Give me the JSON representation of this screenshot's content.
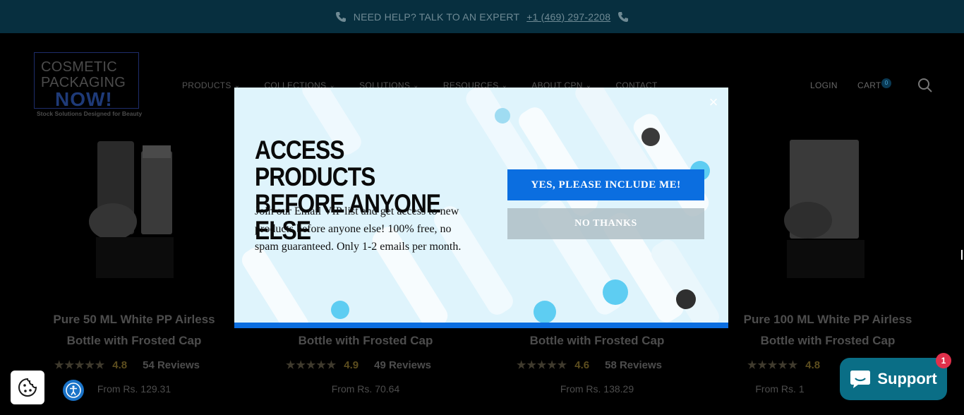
{
  "announcement": {
    "text": "NEED HELP? TALK TO AN EXPERT",
    "phone": "+1 (469) 297-2208"
  },
  "logo": {
    "line1": "COSMETIC",
    "line2": "PACKAGING",
    "line3": "NOW!",
    "tagline": "Stock Solutions Designed for Beauty"
  },
  "nav": {
    "items": [
      {
        "label": "PRODUCTS"
      },
      {
        "label": "COLLECTIONS"
      },
      {
        "label": "SOLUTIONS"
      },
      {
        "label": "RESOURCES"
      },
      {
        "label": "ABOUT CPN"
      },
      {
        "label": "CONTACT"
      }
    ],
    "login": "LOGIN",
    "cart": "CART",
    "cart_count": "0"
  },
  "products": [
    {
      "title_line1": "Pure 50 ML White PP Airless",
      "title_line2": "Bottle with Frosted Cap",
      "stars": "★★★★★",
      "rating": "4.8",
      "reviews": "54 Reviews",
      "price": "From Rs. 129.31"
    },
    {
      "title_line2": "Bottle with Frosted Cap",
      "stars": "★★★★★",
      "rating": "4.9",
      "reviews": "49 Reviews",
      "price": "From Rs. 70.64"
    },
    {
      "title_line2": "Bottle with Frosted Cap",
      "stars": "★★★★★",
      "rating": "4.6",
      "reviews": "58 Reviews",
      "price": "From Rs. 138.29"
    },
    {
      "title_line1": "Pure 100 ML White PP Airless",
      "title_line2": "Bottle with Frosted Cap",
      "stars": "★★★★★",
      "rating": "4.8",
      "price": "From Rs. 1"
    }
  ],
  "popup": {
    "heading_line1": "ACCESS PRODUCTS",
    "heading_line2": "BEFORE ANYONE ELSE",
    "body": "Join our Email VIP list and get access to new products before anyone else! 100% free, no spam guaranteed. Only 1-2 emails per month.",
    "yes_label": "YES, PLEASE INCLUDE ME!",
    "no_label": "NO THANKS",
    "close": "×"
  },
  "support": {
    "label": "Support",
    "badge": "1"
  },
  "colors": {
    "topbar": "#072f3f",
    "accent_blue": "#0b6ee0",
    "support": "#0a6e86",
    "badge": "#e0304b"
  }
}
